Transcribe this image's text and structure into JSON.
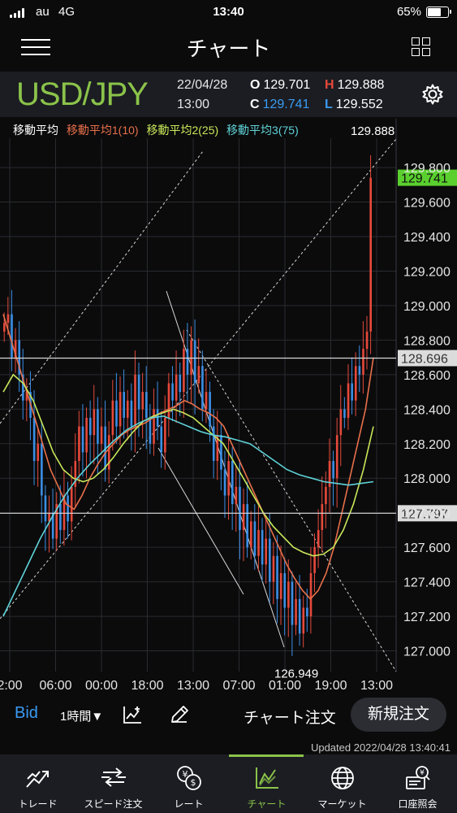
{
  "status": {
    "carrier": "au",
    "network": "4G",
    "time": "13:40",
    "battery": "65%",
    "battery_level": 0.65
  },
  "nav": {
    "title": "チャート",
    "menu_icon": "hamburger-menu-icon",
    "layout_icon": "grid-layout-icon"
  },
  "info": {
    "pair": "USD/JPY",
    "date": "22/04/28",
    "time": "13:00",
    "open_label": "O",
    "open": "129.701",
    "high_label": "H",
    "high": "129.888",
    "close_label": "C",
    "close": "129.741",
    "low_label": "L",
    "low": "129.552",
    "settings_icon": "gear-icon",
    "pair_color": "#8bc34a",
    "high_color": "#e6493b",
    "close_color": "#3b9bf2",
    "low_color": "#3b9bf2"
  },
  "ma_legend": {
    "title": "移動平均",
    "ma1": "移動平均1(10)",
    "ma2": "移動平均2(25)",
    "ma3": "移動平均3(75)",
    "ma1_color": "#e8704a",
    "ma2_color": "#c9e85a",
    "ma3_color": "#5fd3d8"
  },
  "chart_data": {
    "type": "candlestick",
    "symbol": "USD/JPY",
    "timeframe": "1時間",
    "y_ticks": [
      "129.800",
      "129.600",
      "129.400",
      "129.200",
      "129.000",
      "128.800",
      "128.600",
      "128.400",
      "128.200",
      "128.000",
      "127.800",
      "127.600",
      "127.400",
      "127.200",
      "127.000"
    ],
    "y_range": [
      126.88,
      129.97
    ],
    "x_ticks": [
      "2:00",
      "06:00",
      "00:00",
      "18:00",
      "13:00",
      "07:00",
      "01:00",
      "19:00",
      "13:00"
    ],
    "current_price": "129.741",
    "horizontal_lines": [
      "128.696",
      "127.797"
    ],
    "max_label": "129.888",
    "min_label": "126.949",
    "max_value": 129.888,
    "min_value": 126.949,
    "candles_up_color": "#e6493b",
    "candles_down_color": "#3b8fe6",
    "closes": [
      128.9,
      128.95,
      128.7,
      128.8,
      128.6,
      128.45,
      128.5,
      128.35,
      128.1,
      128.2,
      127.9,
      127.75,
      127.8,
      127.65,
      127.85,
      127.7,
      127.9,
      127.75,
      127.95,
      128.1,
      128.3,
      128.15,
      128.35,
      128.25,
      128.4,
      128.2,
      128.3,
      128.05,
      128.25,
      128.45,
      128.3,
      128.5,
      128.35,
      128.45,
      128.3,
      128.6,
      128.4,
      128.5,
      128.35,
      128.2,
      128.4,
      128.3,
      128.15,
      128.35,
      128.55,
      128.45,
      128.6,
      128.5,
      128.75,
      128.6,
      128.8,
      128.55,
      128.65,
      128.4,
      128.5,
      128.3,
      128.1,
      128.25,
      128.05,
      127.9,
      128.1,
      127.85,
      127.95,
      127.7,
      127.85,
      127.6,
      127.75,
      127.55,
      127.7,
      127.5,
      127.65,
      127.4,
      127.55,
      127.3,
      127.45,
      127.25,
      127.4,
      127.15,
      127.3,
      127.1,
      127.25,
      127.2,
      127.45,
      127.6,
      127.7,
      127.85,
      127.95,
      128.1,
      128.0,
      128.25,
      128.4,
      128.35,
      128.55,
      128.45,
      128.65,
      128.6,
      128.75,
      128.85,
      129.741
    ],
    "ma1_10": [
      128.95,
      128.8,
      128.65,
      128.5,
      128.35,
      128.2,
      128.05,
      127.95,
      127.85,
      127.82,
      127.9,
      128.0,
      128.08,
      128.15,
      128.2,
      128.25,
      128.28,
      128.3,
      128.32,
      128.35,
      128.38,
      128.4,
      128.42,
      128.45,
      128.43,
      128.4,
      128.38,
      128.35,
      128.3,
      128.2,
      128.1,
      128.0,
      127.9,
      127.8,
      127.7,
      127.6,
      127.5,
      127.42,
      127.35,
      127.3,
      127.35,
      127.45,
      127.6,
      127.8,
      128.0,
      128.2,
      128.4,
      128.7
    ],
    "ma2_25": [
      128.5,
      128.6,
      128.55,
      128.45,
      128.3,
      128.15,
      128.05,
      128.0,
      127.98,
      128.0,
      128.05,
      128.12,
      128.2,
      128.27,
      128.33,
      128.36,
      128.38,
      128.4,
      128.38,
      128.35,
      128.3,
      128.25,
      128.2,
      128.1,
      128.0,
      127.9,
      127.8,
      127.72,
      127.66,
      127.6,
      127.57,
      127.55,
      127.56,
      127.6,
      127.7,
      127.85,
      128.05,
      128.3
    ],
    "ma3_75": [
      127.2,
      127.35,
      127.5,
      127.65,
      127.78,
      127.9,
      128.0,
      128.08,
      128.15,
      128.22,
      128.28,
      128.32,
      128.35,
      128.36,
      128.33,
      128.3,
      128.27,
      128.25,
      128.24,
      128.22,
      128.2,
      128.15,
      128.1,
      128.05,
      128.02,
      128.0,
      127.98,
      127.97,
      127.96,
      127.97,
      127.98
    ]
  },
  "controls": {
    "bid": "Bid",
    "timeframe": "1時間▼",
    "indicator_icon": "indicator-add-icon",
    "draw_icon": "pencil-icon",
    "chart_order": "チャート注文",
    "new_order": "新規注文"
  },
  "updated": "Updated  2022/04/28 13:40:41",
  "tabs": [
    {
      "label": "トレード",
      "icon": "trade-chart-icon",
      "active": false
    },
    {
      "label": "スピード注文",
      "icon": "speed-order-icon",
      "active": false
    },
    {
      "label": "レート",
      "icon": "rate-coins-icon",
      "active": false
    },
    {
      "label": "チャート",
      "icon": "chart-icon",
      "active": true
    },
    {
      "label": "マーケット",
      "icon": "globe-icon",
      "active": false
    },
    {
      "label": "口座照会",
      "icon": "account-inquiry-icon",
      "active": false
    }
  ]
}
